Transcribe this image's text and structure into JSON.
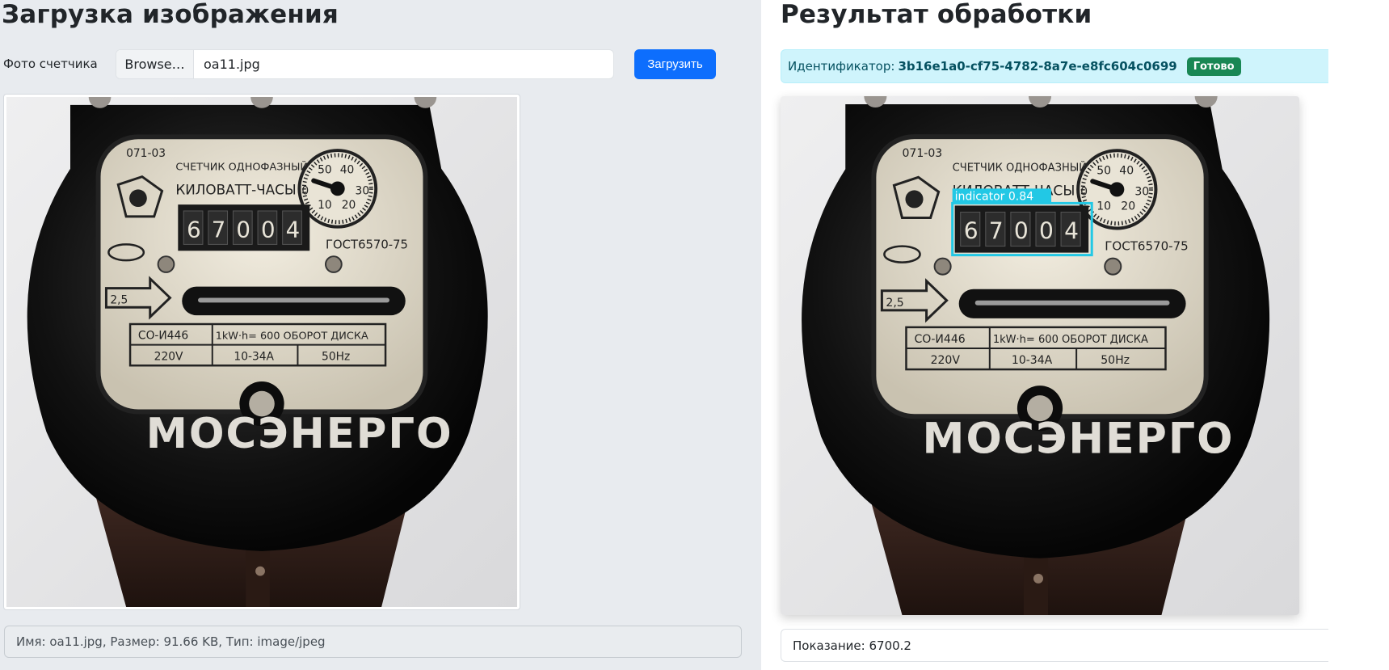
{
  "upload": {
    "title": "Загрузка изображения",
    "photo_label": "Фото счетчика",
    "browse_label": "Browse…",
    "file_name": "oa11.jpg",
    "submit_label": "Загрузить",
    "file_info": "Имя: oa11.jpg, Размер: 91.66 KB, Тип: image/jpeg"
  },
  "result": {
    "title": "Результат обработки",
    "id_label": "Идентификатор:",
    "id_value": "3b16e1a0-cf75-4782-8a7e-e8fc604c0699",
    "status": "Готово",
    "detection_label": "indicator 0.84",
    "reading": "Показание: 6700.2"
  },
  "meter": {
    "model_code": "071-03",
    "type_text": "СЧЕТЧИК ОДНОФАЗНЫЙ",
    "unit_text": "КИЛОВАТТ-ЧАСЫ",
    "digits": [
      "6",
      "7",
      "0",
      "0",
      "4"
    ],
    "standard": "ГОСТ6570-75",
    "class": "2,5",
    "dial_labels": [
      "50",
      "40",
      "30",
      "20",
      "10",
      "0"
    ],
    "table": [
      [
        "СО-И446",
        "1kW·h= 600 ОБОРОТ ДИСКА"
      ],
      [
        "220V",
        "10-34A",
        "50Hz"
      ]
    ],
    "brand": "МОСЭНЕРГО"
  },
  "colors": {
    "primary": "#0d6efd",
    "success": "#198754",
    "info_bg": "#cff4fc",
    "detection_box": "#22c8e5"
  }
}
